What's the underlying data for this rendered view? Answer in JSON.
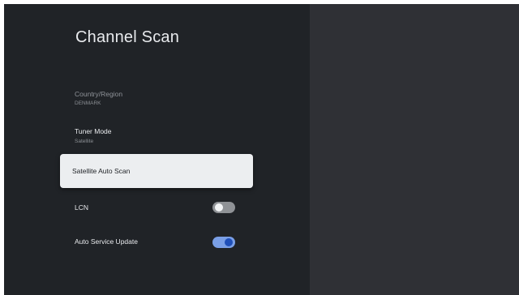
{
  "page": {
    "title": "Channel Scan"
  },
  "settings": {
    "country_region": {
      "label": "Country/Region",
      "value": "DENMARK"
    },
    "tuner_mode": {
      "label": "Tuner Mode",
      "value": "Satellite"
    },
    "satellite_auto_scan": {
      "label": "Satellite Auto Scan",
      "focused": true
    },
    "lcn": {
      "label": "LCN",
      "enabled": false
    },
    "auto_service_update": {
      "label": "Auto Service Update",
      "enabled": true
    }
  },
  "colors": {
    "panel_background": "#202327",
    "screen_background": "#2f3035",
    "focus_background": "#eceef0",
    "toggle_on_track": "#7a9fe6",
    "toggle_on_knob": "#1f4fb8",
    "toggle_off_track": "#8f9296"
  }
}
